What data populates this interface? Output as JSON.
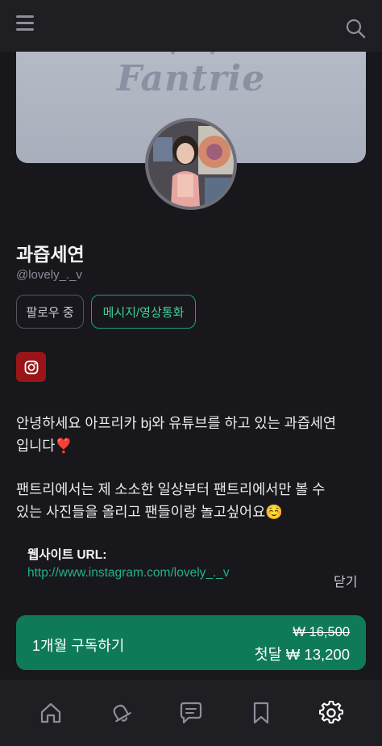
{
  "header": {
    "menu_icon": "hamburger-icon",
    "search_icon": "search-icon"
  },
  "cover": {
    "logo_text": "Fantrie",
    "stars": "★★"
  },
  "profile": {
    "name": "과즙세연",
    "handle": "@lovely_._v",
    "follow_label": "팔로우 중",
    "message_label": "메시지/영상통화",
    "instagram_icon": "instagram-icon"
  },
  "bio": {
    "line1": "안녕하세요 아프리카 bj와 유튜브를 하고 있는 과즙세연입니다❣️",
    "line2": "팬트리에서는 제 소소한 일상부터 팬트리에서만 볼 수 있는 사진들을 올리고 팬들이랑 놀고싶어요☺️"
  },
  "website": {
    "label": "웹사이트 URL:",
    "url": "http://www.instagram.com/lovely_._v",
    "close_label": "닫기"
  },
  "subscribe": {
    "label": "1개월 구독하기",
    "original_price": "₩ 16,500",
    "price": "첫달 ₩ 13,200"
  },
  "bottom_nav": [
    {
      "icon": "home-icon"
    },
    {
      "icon": "bell-icon"
    },
    {
      "icon": "chat-icon"
    },
    {
      "icon": "bookmark-icon"
    },
    {
      "icon": "gear-icon"
    }
  ],
  "colors": {
    "accent": "#0f7a58",
    "link": "#25b18a",
    "background": "#17171c"
  }
}
